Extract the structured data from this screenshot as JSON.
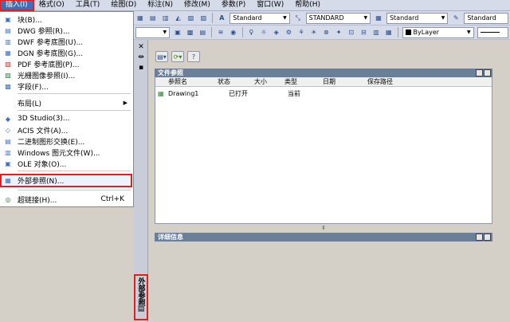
{
  "menubar": [
    "插入(I)",
    "格式(O)",
    "工具(T)",
    "绘图(D)",
    "标注(N)",
    "修改(M)",
    "参数(P)",
    "窗口(W)",
    "帮助(H)"
  ],
  "toolbar": {
    "text_style": "Standard",
    "dim_style": "STANDARD",
    "table_style": "Standard",
    "mleader_style": "Standard",
    "color": "ByLayer"
  },
  "insert_menu": {
    "block": "块(B)...",
    "dwg_ref": "DWG 参照(R)...",
    "dwf_underlay": "DWF 参考底图(U)...",
    "dgn_underlay": "DGN 参考底图(G)...",
    "pdf_underlay": "PDF 参考底图(P)...",
    "raster": "光栅图像参照(I)...",
    "field": "字段(F)...",
    "layout": "布局(L)",
    "studio": "3D Studio(3)...",
    "acis": "ACIS 文件(A)...",
    "binary": "二进制图形交换(E)...",
    "wmf": "Windows 图元文件(W)...",
    "ole": "OLE 对象(O)...",
    "xref": "外部参照(N)...",
    "hyperlink": "超链接(H)...",
    "hyperlink_shortcut": "Ctrl+K"
  },
  "palette": {
    "side_title": "外部参照",
    "file_refs_title": "文件参照",
    "details_title": "详细信息",
    "columns": [
      "参照名",
      "状态",
      "大小",
      "类型",
      "日期",
      "保存路径"
    ],
    "rows": [
      {
        "name": "Drawing1",
        "status": "已打开",
        "size": "",
        "type": "当前",
        "date": "",
        "path": ""
      }
    ]
  }
}
